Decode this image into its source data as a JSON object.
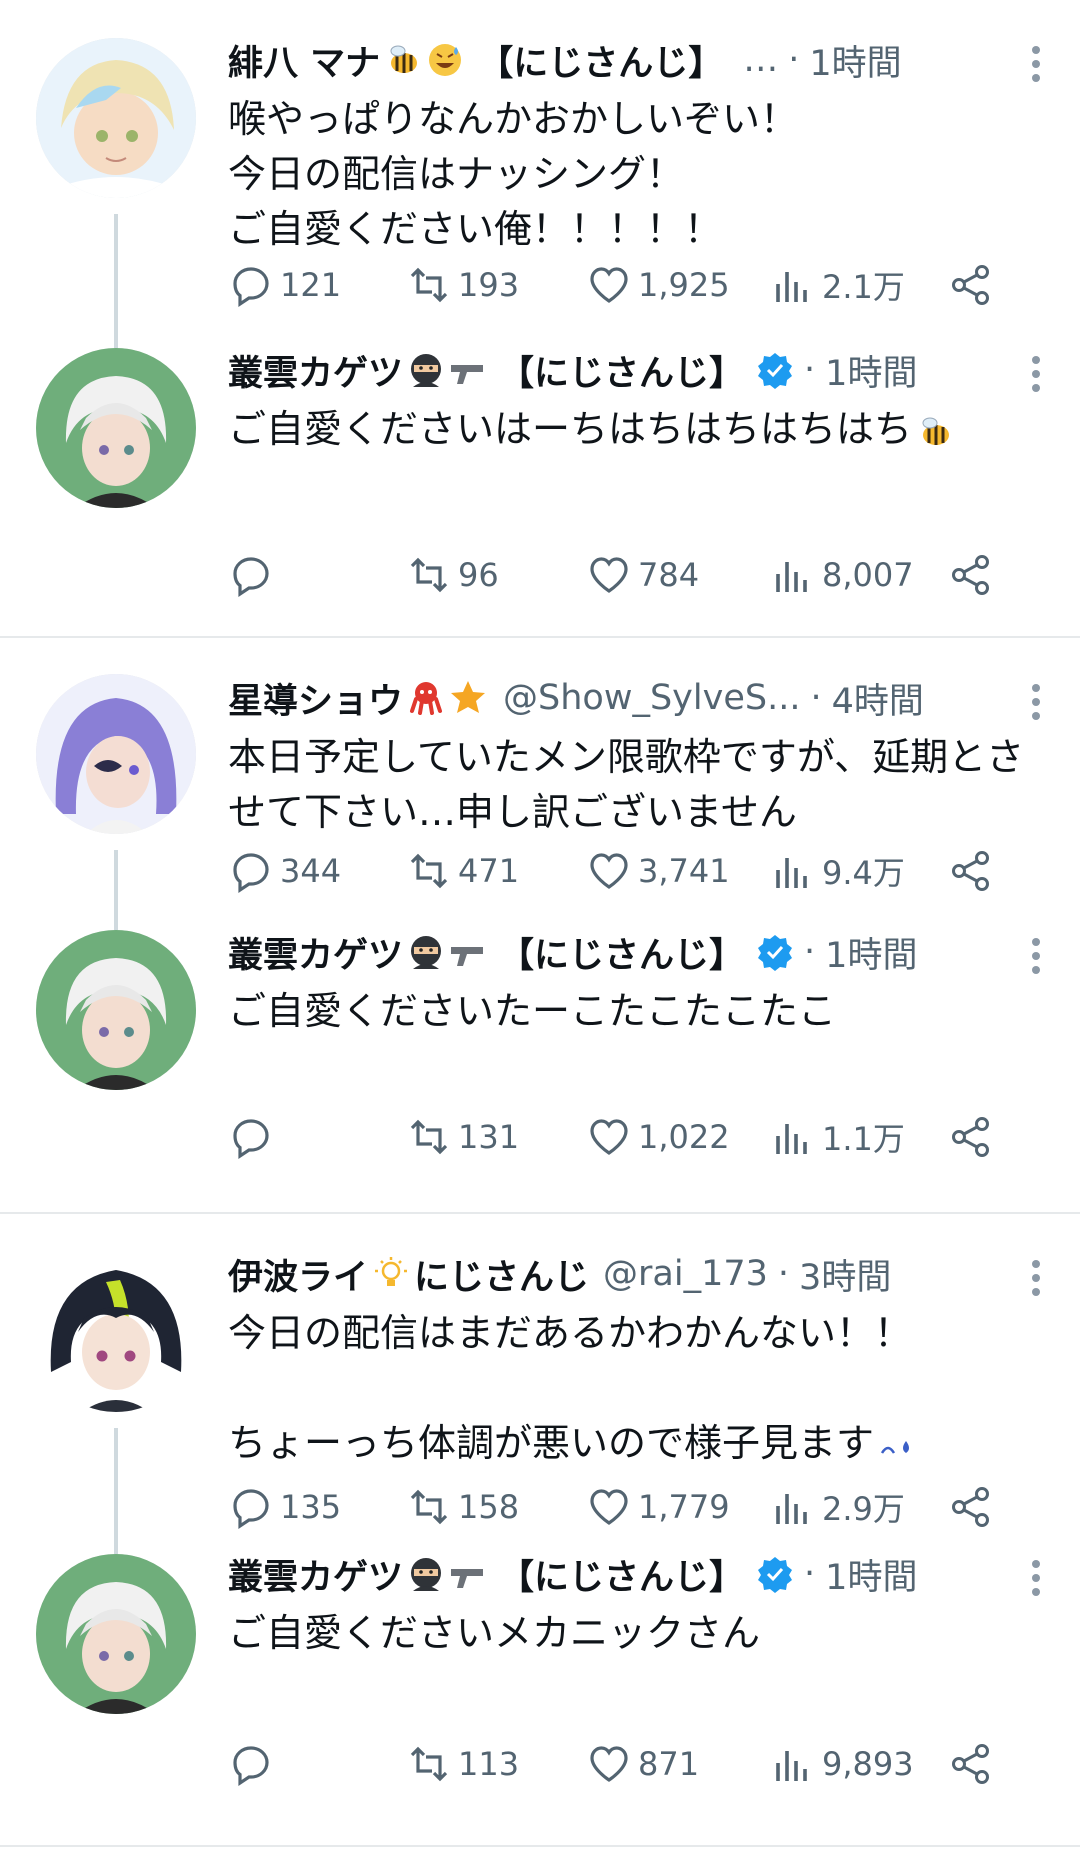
{
  "colors": {
    "secondary": "#536471",
    "verified": "#1d9bf0",
    "thread_line": "#cfd9de",
    "avatar_bg": "#6fae7b"
  },
  "tweets": [
    {
      "name": "緋八 マナ",
      "name_emojis": [
        "bee-icon",
        "sweat-smile-icon"
      ],
      "affiliation": "【にじさんじ】",
      "handle": "…",
      "time": "1時間",
      "body": "喉やっぱりなんかおかしいぞい！\n今日の配信はナッシング！\nご自愛ください俺！！！！！",
      "replies": "121",
      "retweets": "193",
      "likes": "1,925",
      "views": "2.1万",
      "avatar": "blond-hair-avatar"
    },
    {
      "name": "叢雲カゲツ",
      "name_emojis": [
        "ninja-icon",
        "pistol-icon"
      ],
      "affiliation": "【にじさんじ】",
      "verified": true,
      "time": "1時間",
      "body": "ご自愛くださいはーちはちはちはちはち",
      "body_emoji": "bee-icon",
      "replies": "",
      "retweets": "96",
      "likes": "784",
      "views": "8,007",
      "avatar": "white-hair-avatar"
    },
    {
      "name": "星導ショウ",
      "name_emojis": [
        "octopus-icon",
        "star-icon"
      ],
      "handle": "@Show_SylveS...",
      "time": "4時間",
      "body": "本日予定していたメン限歌枠ですが、延期とさせて下さい…申し訳ございません",
      "replies": "344",
      "retweets": "471",
      "likes": "3,741",
      "views": "9.4万",
      "avatar": "purple-hair-avatar"
    },
    {
      "name": "叢雲カゲツ",
      "name_emojis": [
        "ninja-icon",
        "pistol-icon"
      ],
      "affiliation": "【にじさんじ】",
      "verified": true,
      "time": "1時間",
      "body": "ご自愛くださいたーこたこたこたこ",
      "replies": "",
      "retweets": "131",
      "likes": "1,022",
      "views": "1.1万",
      "avatar": "white-hair-avatar"
    },
    {
      "name": "伊波ライ",
      "name_emojis": [
        "light-bulb-icon"
      ],
      "affiliation": "にじさんじ",
      "handle": "@rai_173",
      "time": "3時間",
      "body": "今日の配信はまだあるかわかんない！！\n\nちょーっち体調が悪いので様子見ます",
      "body_emoji": "sweat-icon",
      "replies": "135",
      "retweets": "158",
      "likes": "1,779",
      "views": "2.9万",
      "avatar": "dark-hair-avatar"
    },
    {
      "name": "叢雲カゲツ",
      "name_emojis": [
        "ninja-icon",
        "pistol-icon"
      ],
      "affiliation": "【にじさんじ】",
      "verified": true,
      "time": "1時間",
      "body": "ご自愛くださいメカニックさん",
      "replies": "",
      "retweets": "113",
      "likes": "871",
      "views": "9,893",
      "avatar": "white-hair-avatar"
    }
  ]
}
